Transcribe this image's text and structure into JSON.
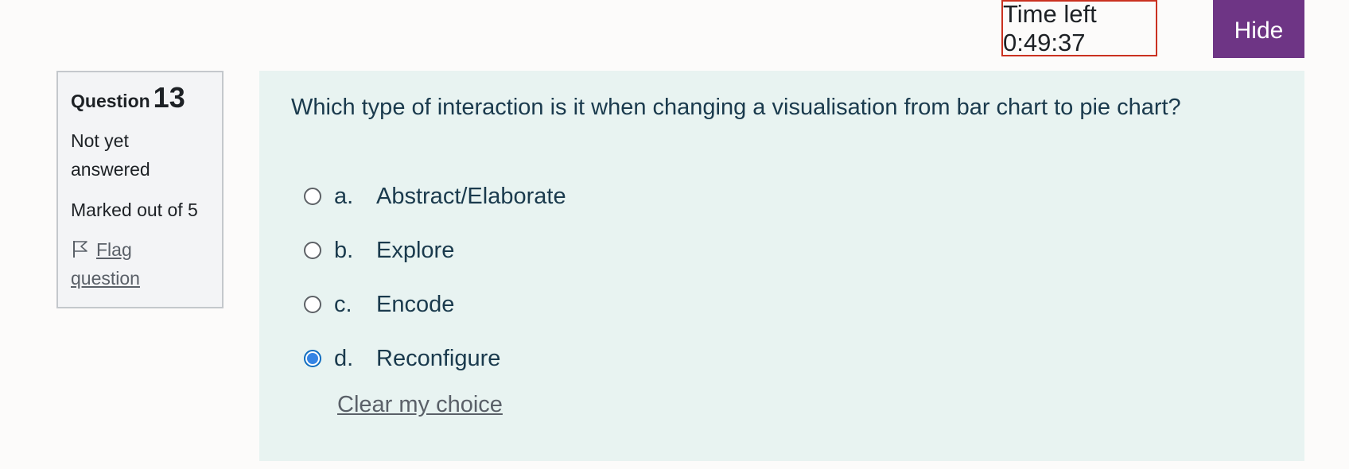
{
  "timer": {
    "label": "Time left 0:49:37"
  },
  "hide_button": {
    "label": "Hide"
  },
  "info": {
    "question_label": "Question",
    "question_number": "13",
    "state_line1": "Not yet",
    "state_line2": "answered",
    "grade": "Marked out of 5",
    "flag_line1": "Flag",
    "flag_line2": "question"
  },
  "question": {
    "text": "Which type of interaction is it when changing a visualisation from bar chart to pie chart?",
    "options": [
      {
        "letter": "a.",
        "label": "Abstract/Elaborate",
        "selected": false
      },
      {
        "letter": "b.",
        "label": "Explore",
        "selected": false
      },
      {
        "letter": "c.",
        "label": "Encode",
        "selected": false
      },
      {
        "letter": "d.",
        "label": "Reconfigure",
        "selected": true
      }
    ],
    "clear_label": "Clear my choice"
  },
  "colors": {
    "accent": "#6e3585",
    "timer_border": "#ca3120",
    "content_bg": "#e8f3f1",
    "radio_selected": "#3584e4"
  },
  "icons": {
    "flag": "flag-icon"
  }
}
